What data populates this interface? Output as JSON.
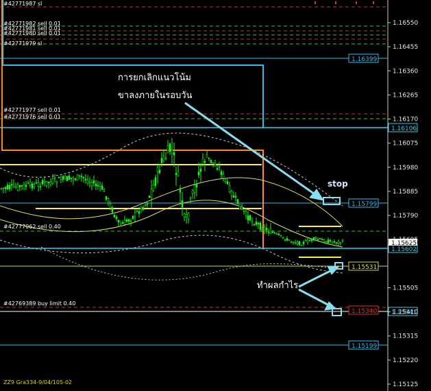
{
  "chart_data": {
    "type": "candlestick",
    "y_axis_ticks": [
      1.1655,
      1.16455,
      1.1636,
      1.16265,
      1.1617,
      1.16075,
      1.1598,
      1.15885,
      1.1579,
      1.15695,
      1.15505,
      1.1541,
      1.15315,
      1.1522,
      1.15125
    ],
    "current_price_label": "1.15625",
    "price_tags": [
      {
        "value": "1.16399",
        "color": "#33bbee"
      },
      {
        "value": "1.16106",
        "color": "#33ccee"
      },
      {
        "value": "1.15799",
        "color": "#33bbee"
      },
      {
        "value": "1.15602",
        "color": "#33ccee"
      },
      {
        "value": "1.15531",
        "color": "#dddd33"
      },
      {
        "value": "1.15341",
        "color": "#33ccee"
      },
      {
        "value": "1.15199",
        "color": "#33bbee"
      }
    ],
    "hidden_tag": {
      "value": "1.15340",
      "color": "#dd3333"
    },
    "order_labels": [
      {
        "text": "#42771987 sl"
      },
      {
        "text": "#42771982 sell 0.01"
      },
      {
        "text": "#42771981 sell 0.01"
      },
      {
        "text": "#42771980 sell 0.01"
      },
      {
        "text": "#42771979 sl"
      },
      {
        "text": "#42771977 sell 0.01"
      },
      {
        "text": "#42771976 sell 0.01"
      },
      {
        "text": "#42777062 sell 0.40"
      },
      {
        "text": "#42769389 buy limit 0.40"
      }
    ],
    "annotations": {
      "line1": "การยกเลิกแนวโน้ม",
      "line2": "ขาลงภายในรอบวัน",
      "stop": "stop",
      "take_profit": "ทำผลกำไร"
    },
    "footer": "ZZ9 Gra334-9/04/105-02",
    "colors": {
      "candle": "#22ee22",
      "cyan": "#33ccee",
      "orange": "#ff8c1a",
      "yellow": "#ffee44",
      "annotation_arrow": "#88ddee"
    }
  }
}
